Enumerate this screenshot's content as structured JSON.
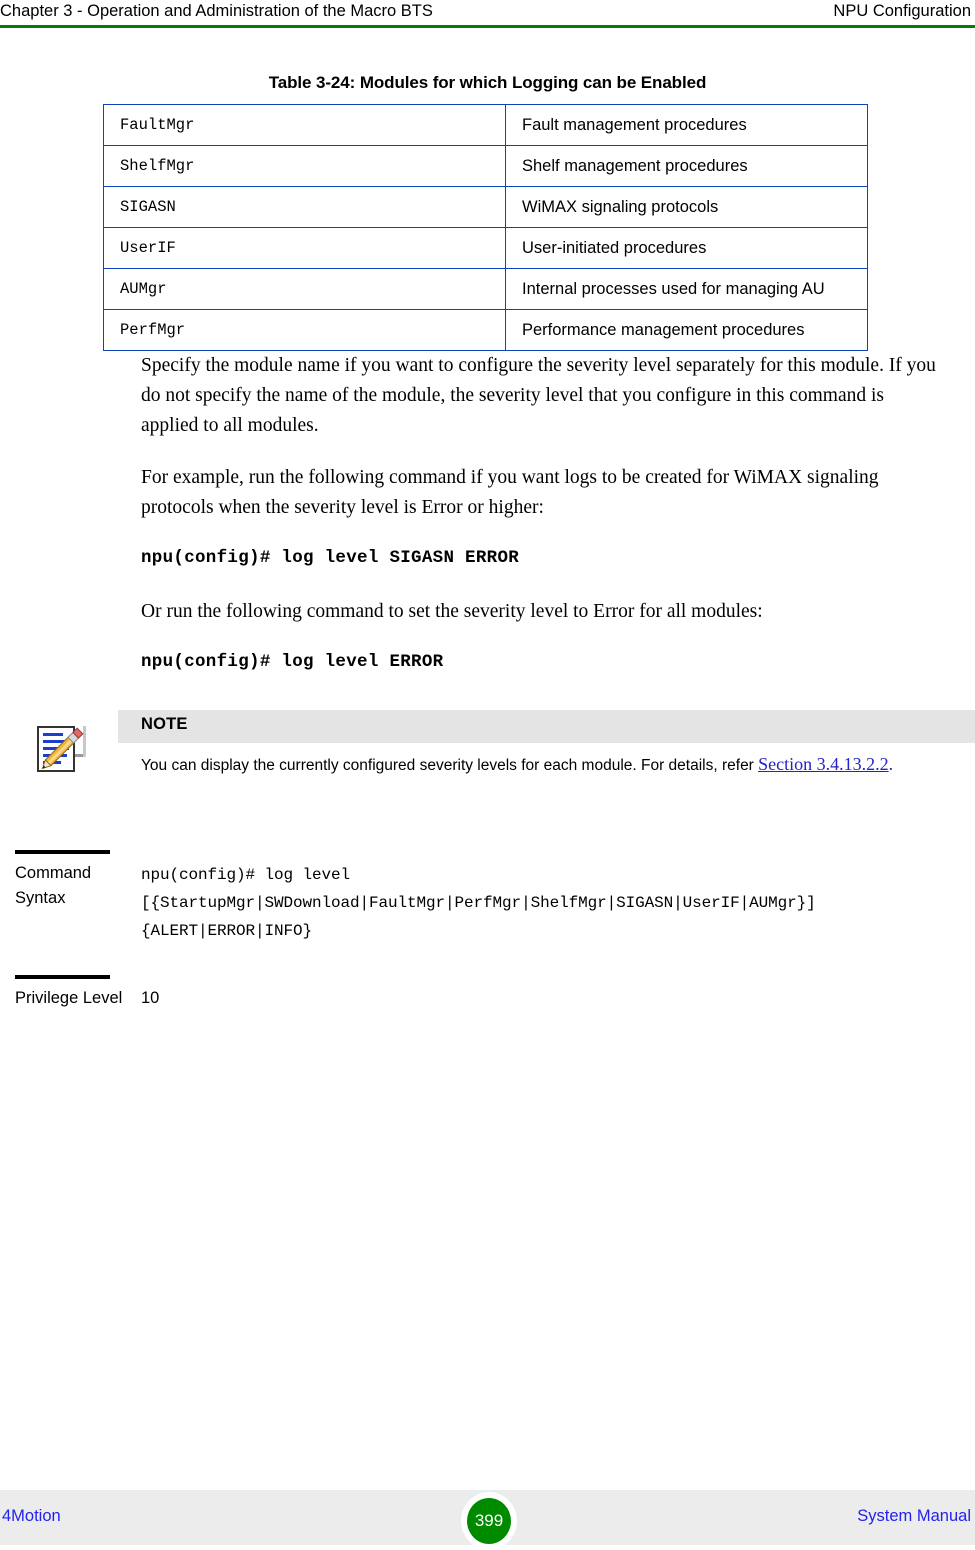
{
  "header": {
    "left": "Chapter 3 - Operation and Administration of the Macro BTS",
    "right": "NPU Configuration",
    "rule_color": "#008000"
  },
  "table": {
    "caption": "Table 3-24: Modules for which Logging can be Enabled",
    "border_color": "#1043b6",
    "rows": [
      {
        "module": "FaultMgr",
        "description": "Fault management procedures"
      },
      {
        "module": "ShelfMgr",
        "description": "Shelf management procedures"
      },
      {
        "module": "SIGASN",
        "description": "WiMAX signaling protocols"
      },
      {
        "module": "UserIF",
        "description": "User-initiated procedures"
      },
      {
        "module": "AUMgr",
        "description": "Internal processes used for managing AU"
      },
      {
        "module": "PerfMgr",
        "description": "Performance management procedures"
      }
    ]
  },
  "body": {
    "para1": "Specify the module name if you want to configure the severity level separately for this module. If you do not specify the name of the module, the severity level that you configure in this command is applied to all modules.",
    "para2": "For example, run the following command if you want logs to be created for WiMAX signaling protocols when the severity level is Error or higher:",
    "command1": "npu(config)# log level SIGASN ERROR",
    "para3": "Or run the following command to set the severity level to Error for all modules:",
    "command2": "npu(config)# log level ERROR"
  },
  "note": {
    "icon": "note-pencil-document-icon",
    "title": "NOTE",
    "text": "You can display the currently configured severity levels for each module. For details, refer ",
    "link": "Section 3.4.13.2.2",
    "link_color": "#2222cc",
    "link_suffix": ".",
    "band_color": "#e4e4e4"
  },
  "command_syntax": {
    "label": "Command Syntax",
    "lines": [
      "npu(config)# log level",
      "[{StartupMgr|SWDownload|FaultMgr|PerfMgr|ShelfMgr|SIGASN|UserIF|AUMgr}]",
      "{ALERT|ERROR|INFO}"
    ]
  },
  "privilege": {
    "label": "Privilege Level",
    "value": "10"
  },
  "footer": {
    "left": "4Motion",
    "page_number": "399",
    "right": "System Manual",
    "badge_color": "#008a00",
    "band_color": "#ececec",
    "text_color": "#2222ee"
  }
}
